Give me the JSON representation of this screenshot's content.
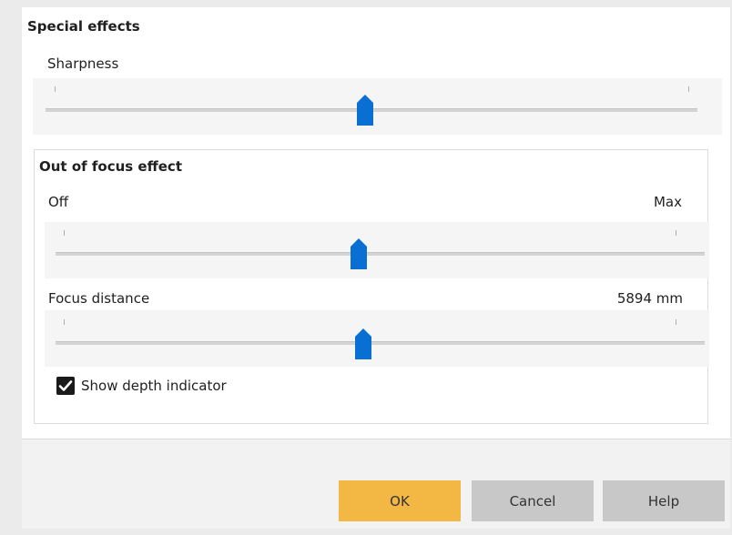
{
  "special_effects": {
    "title": "Special effects",
    "sharpness": {
      "label": "Sharpness",
      "value_fraction": 0.49
    }
  },
  "out_of_focus": {
    "title": "Out of focus effect",
    "strength": {
      "min_label": "Off",
      "max_label": "Max",
      "value_fraction": 0.49
    },
    "focus_distance": {
      "label": "Focus distance",
      "value": "5894 mm",
      "value_fraction": 0.49
    },
    "show_depth_indicator": {
      "label": "Show depth indicator",
      "checked": true
    }
  },
  "buttons": {
    "ok": "OK",
    "cancel": "Cancel",
    "help": "Help"
  },
  "colors": {
    "accent": "#0a6fd3",
    "ok_button": "#f3b843",
    "secondary_button": "#c8c8c8"
  }
}
